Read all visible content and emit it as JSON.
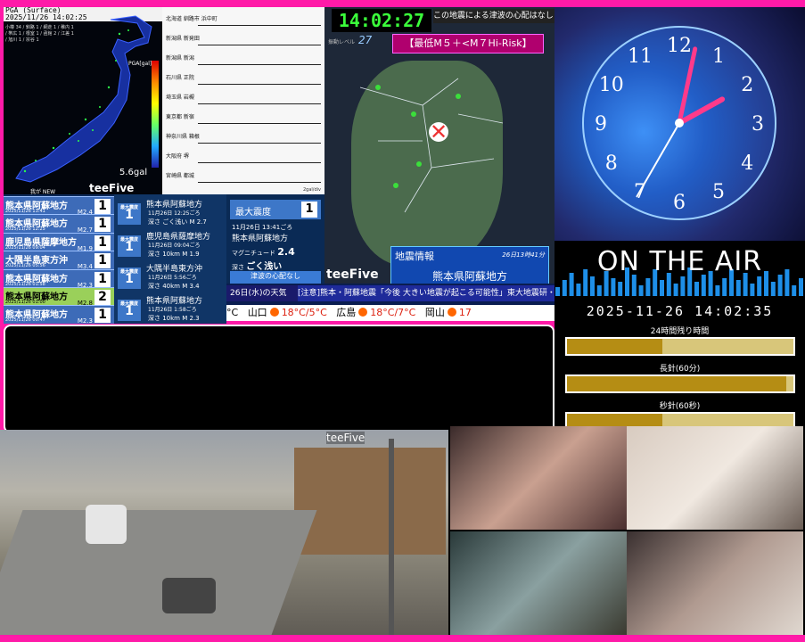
{
  "jp_map": {
    "header_line1": "PGA (Surface)",
    "header_line2": "2025/11/26 14:02:25",
    "pga_label": "PGA[gal]",
    "pga_value": "5.6gal",
    "station": "5.6gal",
    "legend": "我が NEW",
    "brand": "teeFive",
    "stations": "小樽 34 / 釧路 1 / 網走 1 / 稚内 1 / 帯広 1 / 根室 1 / 函館 2 / 江差 1 / 旭川 1 / 宗谷 1"
  },
  "wave": {
    "labels": [
      "北海道 釧路市 浜中町",
      "新潟県 新発田",
      "新潟県 新潟",
      "石川県 正院",
      "埼玉県 岩槻",
      "東京都 新宿",
      "神奈川県 箱根",
      "大阪府 堺",
      "宮崎県 都城"
    ],
    "footer": "2gal/div"
  },
  "eq_list": [
    {
      "name": "熊本県阿蘇地方",
      "time": "2025/11/26 13:41",
      "mag": "M2.4",
      "intensity": "1",
      "highlight": false
    },
    {
      "name": "熊本県阿蘇地方",
      "time": "2025/11/26 12:25",
      "mag": "M2.7",
      "intensity": "1",
      "highlight": false
    },
    {
      "name": "鹿児島県薩摩地方",
      "time": "2025/11/26 09:04",
      "mag": "M1.9",
      "intensity": "1",
      "highlight": false
    },
    {
      "name": "大隅半島東方沖",
      "time": "2025/11/26 05:56",
      "mag": "M3.4",
      "intensity": "1",
      "highlight": false
    },
    {
      "name": "熊本県阿蘇地方",
      "time": "2025/11/26 01:58",
      "mag": "M2.3",
      "intensity": "1",
      "highlight": false
    },
    {
      "name": "熊本県阿蘇地方",
      "time": "2025/11/26 01:00",
      "mag": "M2.8",
      "intensity": "2",
      "highlight": true
    },
    {
      "name": "熊本県阿蘇地方",
      "time": "2025/11/26 00:47",
      "mag": "M2.3",
      "intensity": "1",
      "highlight": false
    }
  ],
  "eq_detail": [
    {
      "int_label": "最大震度",
      "int": "1",
      "name": "熊本県阿蘇地方",
      "time": "11月26日 12:25ごろ",
      "meta": "深さ ごく浅い  M 2.7"
    },
    {
      "int_label": "最大震度",
      "int": "1",
      "name": "鹿児島県薩摩地方",
      "time": "11月26日 09:04ごろ",
      "meta": "深さ 10km  M 1.9"
    },
    {
      "int_label": "最大震度",
      "int": "1",
      "name": "大隅半島東方沖",
      "time": "11月26日 5:56ごろ",
      "meta": "深さ 40km  M 3.4"
    },
    {
      "int_label": "最大震度",
      "int": "1",
      "name": "熊本県阿蘇地方",
      "time": "11月26日 1:58ごろ",
      "meta": "深さ 10km  M 2.3"
    }
  ],
  "summary": {
    "max_label": "最大震度",
    "max_int": "1",
    "time": "11月26日 13:41ごろ",
    "area": "熊本県阿蘇地方",
    "mag_label": "マグニチュード",
    "mag": "2.4",
    "depth_label": "深さ",
    "depth": "ごく浅い",
    "tsunami": "津波の心配なし"
  },
  "scroll": {
    "weather": "26日(水)の天気",
    "ticker": "[注意]熊本・阿蘇地震「今後 大きい地震が起こる可能性」東大地震研・笠原教授",
    "cities": [
      {
        "city": "山口",
        "temp": "18°C/5°C"
      },
      {
        "city": "広島",
        "temp": "18°C/7°C"
      },
      {
        "city": "岡山",
        "temp": "17"
      }
    ],
    "prefix": "°C"
  },
  "kyushu": {
    "clock": "14:02:27",
    "note": "この地震による津波の心配はなし",
    "shindo_label": "振動レベル",
    "shindo": "27",
    "risk": "【最低M５＋<M７Hi-Risk】",
    "info_title": "地震情報",
    "info_date": "26日13時41分",
    "info_area": "熊本県阿蘇地方",
    "brand": "teeFive"
  },
  "clock_face": {
    "numbers": [
      "12",
      "1",
      "2",
      "3",
      "4",
      "5",
      "6",
      "7",
      "8",
      "9",
      "10",
      "11"
    ],
    "hour_angle": 61,
    "minute_angle": 12,
    "second_angle": 210
  },
  "air": {
    "title": "ON THE AIR"
  },
  "timers": {
    "datetime": "2025-11-26 14:02:35",
    "items": [
      {
        "label": "24時間残り時間",
        "fraction": 0.42
      },
      {
        "label": "長針(60分)",
        "fraction": 0.97
      },
      {
        "label": "秒針(60秒)",
        "fraction": 0.42
      }
    ]
  },
  "camera": {
    "brand": "teeFive"
  },
  "colors": {
    "frame": "#ff1aa8",
    "clock_green": "#3bff3b",
    "risk": "#b0006e"
  }
}
